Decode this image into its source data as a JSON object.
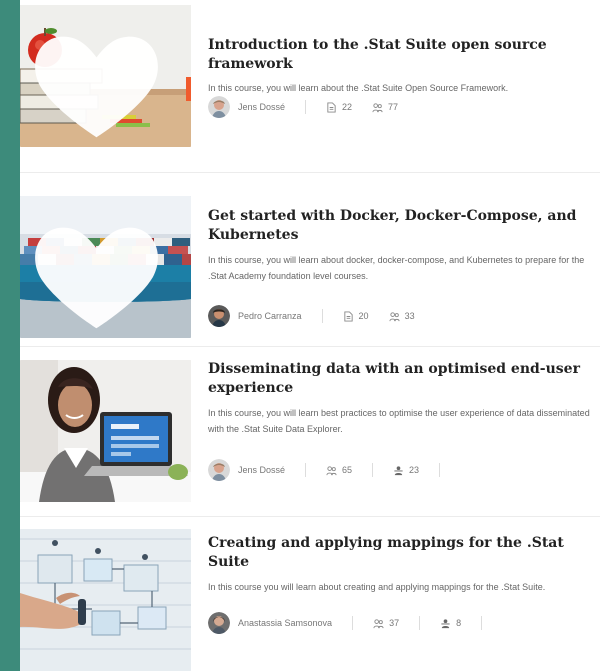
{
  "courses": [
    {
      "title": "Introduction to the .Stat Suite open source framework",
      "description": "In this course, you will learn about the .Stat Suite Open Source Framework.",
      "author": "Jens Dossé",
      "stats": [
        {
          "icon": "document-icon",
          "value": "22"
        },
        {
          "icon": "users-icon",
          "value": "77"
        }
      ]
    },
    {
      "title": "Get started with Docker, Docker-Compose, and Kubernetes",
      "description": "In this course, you will learn about docker, docker-compose, and Kubernetes to prepare for the .Stat Academy foundation level courses.",
      "author": "Pedro Carranza",
      "stats": [
        {
          "icon": "document-icon",
          "value": "20"
        },
        {
          "icon": "users-icon",
          "value": "33"
        }
      ]
    },
    {
      "title": "Disseminating data with an optimised end-user experience",
      "description": "In this course, you will learn best practices to optimise the user experience of data disseminated with the .Stat Suite Data Explorer.",
      "author": "Jens Dossé",
      "stats": [
        {
          "icon": "users-icon",
          "value": "65"
        },
        {
          "icon": "teacher-icon",
          "value": "23"
        }
      ]
    },
    {
      "title": "Creating and applying mappings for the .Stat Suite",
      "description": "In this course you will learn about creating and applying mappings for the .Stat Suite.",
      "author": "Anastassia Samsonova",
      "stats": [
        {
          "icon": "users-icon",
          "value": "37"
        },
        {
          "icon": "teacher-icon",
          "value": "8"
        }
      ]
    }
  ],
  "colors": {
    "accent": "#3d8b7b",
    "title": "#222222",
    "muted": "#777777"
  }
}
